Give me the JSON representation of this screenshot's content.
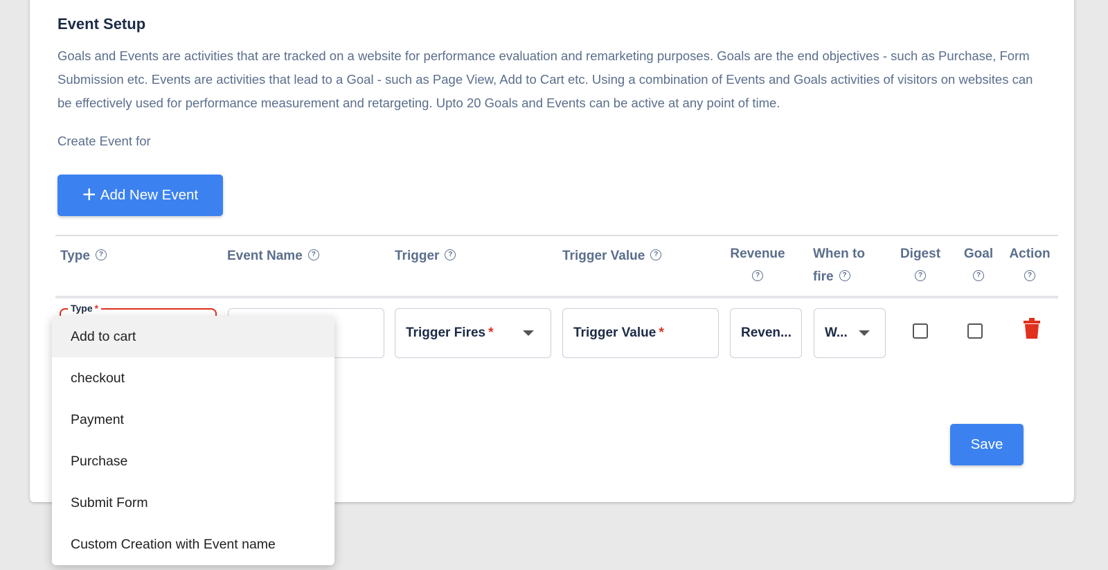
{
  "section": {
    "title": "Event Setup",
    "description": "Goals and Events are activities that are tracked on a website for performance evaluation and remarketing purposes. Goals are the end objectives - such as Purchase, Form Submission etc. Events are activities that lead to a Goal - such as Page View, Add to Cart etc. Using a combination of Events and Goals activities of visitors on websites can be effectively used for performance measurement and retargeting. Upto 20 Goals and Events can be active at any point of time.",
    "create_label": "Create Event for"
  },
  "add_button": {
    "icon": "plus-icon",
    "label": "Add New Event"
  },
  "table": {
    "headers": {
      "type": "Type",
      "event_name": "Event Name",
      "trigger": "Trigger",
      "trigger_value": "Trigger Value",
      "revenue": "Revenue",
      "when_to_fire_1": "When to",
      "when_to_fire_2": "fire",
      "digest": "Digest",
      "goal": "Goal",
      "action": "Action"
    },
    "help_icon": "question-circle-icon",
    "row": {
      "type_label": "Type",
      "trigger_placeholder": "Trigger Fires",
      "trigger_value_placeholder": "Trigger Value",
      "revenue_placeholder": "Reven...",
      "when_placeholder": "W...",
      "required_mark": "*",
      "digest_checked": false,
      "goal_checked": false,
      "delete_icon": "trash-icon"
    }
  },
  "dropdown": {
    "options": [
      "Add to cart",
      "checkout",
      "Payment",
      "Purchase",
      "Submit Form",
      "Custom Creation with Event name"
    ],
    "highlighted": "Add to cart"
  },
  "save_button": {
    "label": "Save"
  },
  "colors": {
    "primary": "#3b82f0",
    "required": "#e0301e",
    "heading": "#1c2a45",
    "muted": "#5b6e8c",
    "danger": "#e0301e"
  }
}
